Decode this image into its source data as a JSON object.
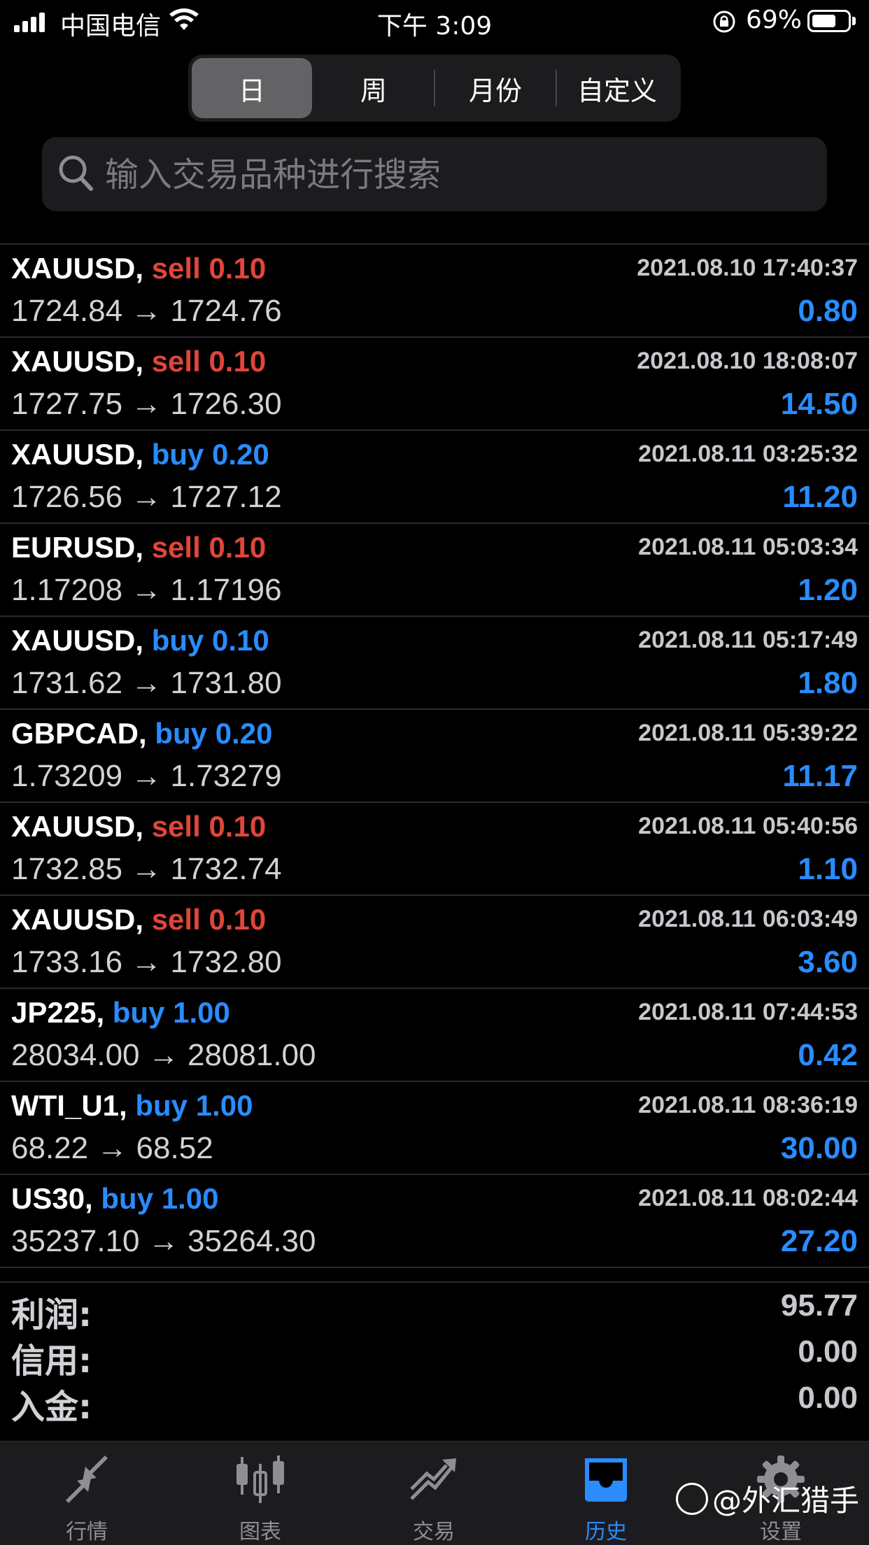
{
  "status_bar": {
    "carrier": "中国电信",
    "time": "下午 3:09",
    "battery_percent": "69%",
    "battery_level": 0.69
  },
  "segments": [
    {
      "label": "日",
      "active": true
    },
    {
      "label": "周",
      "active": false
    },
    {
      "label": "月份",
      "active": false
    },
    {
      "label": "自定义",
      "active": false
    }
  ],
  "search": {
    "placeholder": "输入交易品种进行搜索"
  },
  "trades": [
    {
      "symbol": "XAUUSD,",
      "side": "sell",
      "volume": "0.10",
      "time": "2021.08.10 17:40:37",
      "prices": "1724.84 → 1724.76",
      "profit": "0.80"
    },
    {
      "symbol": "XAUUSD,",
      "side": "sell",
      "volume": "0.10",
      "time": "2021.08.10 18:08:07",
      "prices": "1727.75 → 1726.30",
      "profit": "14.50"
    },
    {
      "symbol": "XAUUSD,",
      "side": "buy",
      "volume": "0.20",
      "time": "2021.08.11 03:25:32",
      "prices": "1726.56 → 1727.12",
      "profit": "11.20"
    },
    {
      "symbol": "EURUSD,",
      "side": "sell",
      "volume": "0.10",
      "time": "2021.08.11 05:03:34",
      "prices": "1.17208 → 1.17196",
      "profit": "1.20"
    },
    {
      "symbol": "XAUUSD,",
      "side": "buy",
      "volume": "0.10",
      "time": "2021.08.11 05:17:49",
      "prices": "1731.62 → 1731.80",
      "profit": "1.80"
    },
    {
      "symbol": "GBPCAD,",
      "side": "buy",
      "volume": "0.20",
      "time": "2021.08.11 05:39:22",
      "prices": "1.73209 → 1.73279",
      "profit": "11.17"
    },
    {
      "symbol": "XAUUSD,",
      "side": "sell",
      "volume": "0.10",
      "time": "2021.08.11 05:40:56",
      "prices": "1732.85 → 1732.74",
      "profit": "1.10"
    },
    {
      "symbol": "XAUUSD,",
      "side": "sell",
      "volume": "0.10",
      "time": "2021.08.11 06:03:49",
      "prices": "1733.16 → 1732.80",
      "profit": "3.60"
    },
    {
      "symbol": "JP225,",
      "side": "buy",
      "volume": "1.00",
      "time": "2021.08.11 07:44:53",
      "prices": "28034.00 → 28081.00",
      "profit": "0.42"
    },
    {
      "symbol": "WTI_U1,",
      "side": "buy",
      "volume": "1.00",
      "time": "2021.08.11 08:36:19",
      "prices": "68.22 → 68.52",
      "profit": "30.00"
    },
    {
      "symbol": "US30,",
      "side": "buy",
      "volume": "1.00",
      "time": "2021.08.11 08:02:44",
      "prices": "35237.10 → 35264.30",
      "profit": "27.20"
    }
  ],
  "summary": [
    {
      "label": "利润:",
      "value": "95.77"
    },
    {
      "label": "信用:",
      "value": "0.00"
    },
    {
      "label": "入金:",
      "value": "0.00"
    }
  ],
  "tabs": [
    {
      "label": "行情",
      "icon": "quotes-arrows-icon",
      "active": false
    },
    {
      "label": "图表",
      "icon": "candlestick-icon",
      "active": false
    },
    {
      "label": "交易",
      "icon": "trade-trend-icon",
      "active": false
    },
    {
      "label": "历史",
      "icon": "history-inbox-icon",
      "active": true
    },
    {
      "label": "设置",
      "icon": "gear-icon",
      "active": false
    }
  ],
  "watermark": "@外汇猎手",
  "colors": {
    "sell": "#e0453a",
    "buy": "#2a8cff",
    "profit": "#2a8cff",
    "background": "#000000"
  }
}
